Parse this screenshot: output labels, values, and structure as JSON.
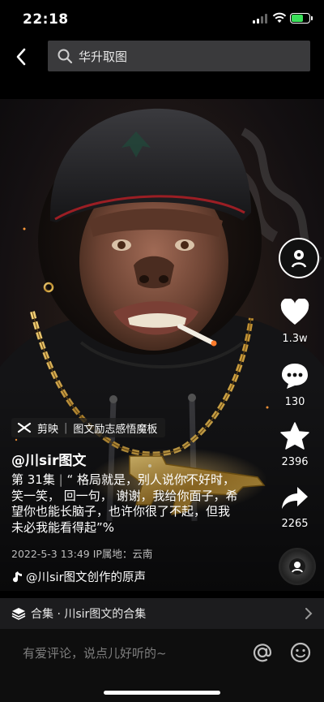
{
  "status_bar": {
    "time": "22:18",
    "battery_level": 0.7
  },
  "header": {
    "search_query": "华升取图",
    "icons": {
      "back": "chevron-left-icon",
      "search": "search-icon"
    }
  },
  "video": {
    "description": "ape in black cap and hoodie with gold chain and cigarette"
  },
  "actions": {
    "likes": "1.3w",
    "comments": "130",
    "favorites": "2396",
    "shares": "2265"
  },
  "caption": {
    "app_tag": "剪映",
    "template_tag": "图文励志感悟魔板",
    "author": "@川sir图文",
    "episode": "第 31集",
    "text": "“ 格局就是，别人说你不好时，笑一笑， 回一句，  谢谢，我给你面子，希望你也能长脑子，也许你很了不起，但我未必我能看得起”%",
    "date_location": "2022-5-3 13:49   IP属地：云南",
    "music": "@川sir图文创作的原声"
  },
  "collection": {
    "label": "合集 · 川sir图文的合集"
  },
  "comment": {
    "placeholder": "有爱评论，说点儿好听的~"
  },
  "colors": {
    "accent_battery": "#3be05a",
    "collection_bg": "#1c1c1e",
    "search_bg": "#3a3a3c"
  }
}
